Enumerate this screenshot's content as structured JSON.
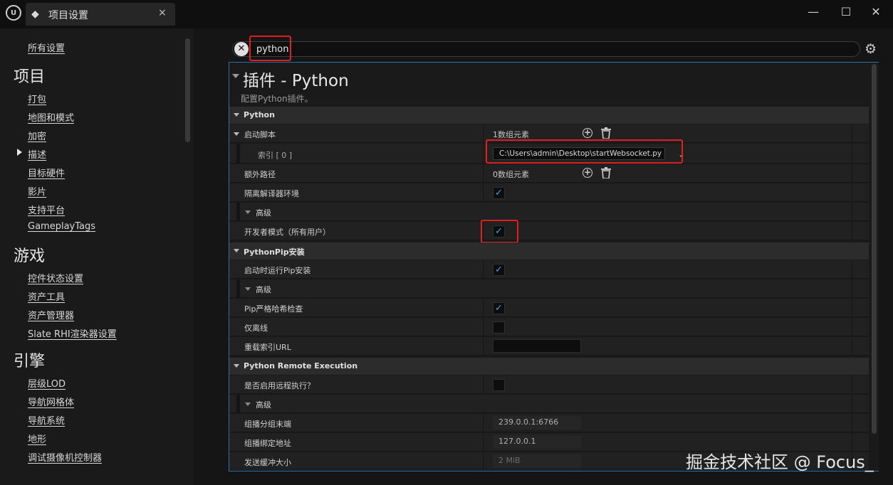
{
  "window": {
    "tab_title": "项目设置",
    "tab_close": "×",
    "controls": {
      "minimize": "—",
      "maximize": "☐",
      "close": "✕"
    }
  },
  "nav": {
    "all_settings": "所有设置",
    "sections": [
      {
        "heading": "项目",
        "items": [
          "打包",
          "地图和模式",
          "加密",
          "描述",
          "目标硬件",
          "影片",
          "支持平台",
          "GameplayTags"
        ]
      },
      {
        "heading": "游戏",
        "items": [
          "控件状态设置",
          "资产工具",
          "资产管理器",
          "Slate RHI渲染器设置"
        ]
      },
      {
        "heading": "引擎",
        "items": [
          "层级LOD",
          "导航网格体",
          "导航系统",
          "地形",
          "调试摄像机控制器"
        ]
      }
    ],
    "active_item": "描述"
  },
  "search": {
    "value": "python",
    "clear_glyph": "✕"
  },
  "panel": {
    "title": "插件 - Python",
    "description": "配置Python插件。",
    "categories": {
      "python": "Python",
      "pip": "PythonPip安装",
      "remote": "Python Remote Execution"
    },
    "rows": {
      "startup_scripts": {
        "label": "启动脚本",
        "value": "1数组元素"
      },
      "index0": {
        "label": "索引 [ 0 ]",
        "value": "C:\\Users\\admin\\Desktop\\startWebsocket.py"
      },
      "extra_paths": {
        "label": "额外路径",
        "value": "0数组元素"
      },
      "isolate": {
        "label": "隔离解译器环境",
        "checked": true
      },
      "advanced1": {
        "label": "高级"
      },
      "dev_mode": {
        "label": "开发者模式（所有用户）",
        "checked": true
      },
      "pip_on_startup": {
        "label": "启动时运行Pip安装",
        "checked": true
      },
      "advanced2": {
        "label": "高级"
      },
      "pip_strict": {
        "label": "Pip严格哈希检查",
        "checked": true
      },
      "offline": {
        "label": "仅离线",
        "checked": false
      },
      "index_url": {
        "label": "重载索引URL",
        "value": ""
      },
      "remote_enable": {
        "label": "是否启用远程执行？",
        "checked": false
      },
      "advanced3": {
        "label": "高级"
      },
      "multicast_group": {
        "label": "组播分组末端",
        "value": "239.0.0.1:6766"
      },
      "multicast_bind": {
        "label": "组播绑定地址",
        "value": "127.0.0.1"
      },
      "send_buffer": {
        "label": "发送缓冲大小",
        "value": "2 MiB"
      }
    },
    "check_glyph": "✓"
  },
  "watermark": "掘金技术社区 @ Focus_",
  "colors": {
    "accent": "#2a6fa8",
    "highlight": "#e02020",
    "check": "#4a9ff0"
  }
}
